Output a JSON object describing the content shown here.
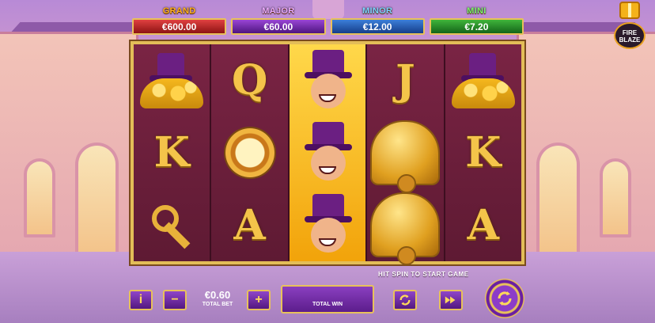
{
  "jackpots": [
    {
      "name": "GRAND",
      "value": "€600.00"
    },
    {
      "name": "MAJOR",
      "value": "€60.00"
    },
    {
      "name": "MINOR",
      "value": "€12.00"
    },
    {
      "name": "MINI",
      "value": "€7.20"
    }
  ],
  "logo": {
    "line1": "FIRE",
    "line2": "BLAZE"
  },
  "reels": [
    [
      "coin-pile",
      "K",
      "key"
    ],
    [
      "Q",
      "pocket-watch",
      "A"
    ],
    [
      "wild-character",
      "wild-character",
      "wild-character"
    ],
    [
      "J",
      "bell",
      "bell"
    ],
    [
      "coin-pile",
      "K",
      "A"
    ]
  ],
  "controls": {
    "hint": "HIT SPIN TO START GAME",
    "bet_value": "€0.60",
    "bet_label": "TOTAL BET",
    "total_win_label": "TOTAL WIN",
    "info": "i",
    "minus": "−",
    "plus": "+"
  }
}
